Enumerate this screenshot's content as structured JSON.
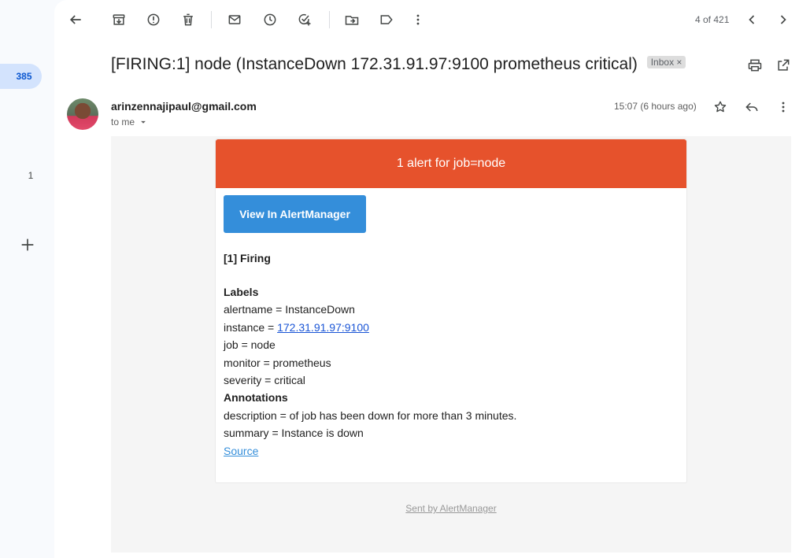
{
  "rail": {
    "inbox_count": "385",
    "other_count": "1"
  },
  "toolbar": {
    "pager": "4 of 421"
  },
  "email": {
    "subject": "[FIRING:1] node (InstanceDown 172.31.91.97:9100 prometheus critical)",
    "label": "Inbox",
    "label_close": "×",
    "sender": "arinzennajipaul@gmail.com",
    "recipient": "to me",
    "time": "15:07 (6 hours ago)"
  },
  "alert": {
    "header": "1 alert for job=node",
    "button": "View In AlertManager",
    "firing": "[1] Firing",
    "labels_heading": "Labels",
    "alertname": "alertname = InstanceDown",
    "instance_prefix": "instance = ",
    "instance_link": "172.31.91.97:9100",
    "job": "job = node",
    "monitor": "monitor = prometheus",
    "severity": "severity = critical",
    "annotations_heading": "Annotations",
    "description": "description = of job has been down for more than 3 minutes.",
    "summary": "summary = Instance is down",
    "source": "Source",
    "footer": "Sent by AlertManager"
  },
  "colors": {
    "alert_header": "#e6522c",
    "button": "#348eda",
    "rail_badge": "#d3e3fd"
  }
}
